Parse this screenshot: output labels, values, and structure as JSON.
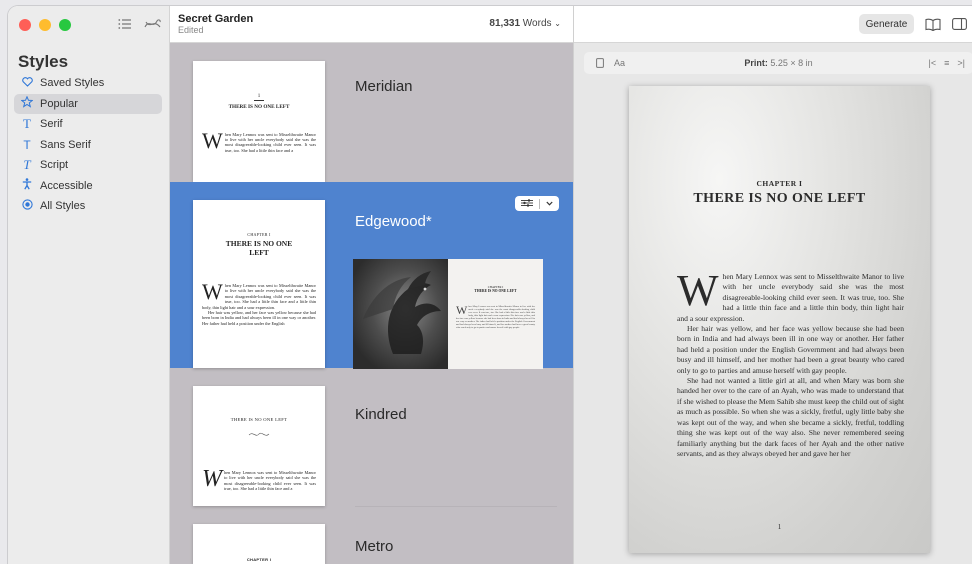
{
  "colors": {
    "accent": "#2f77d8",
    "selected_row": "#4f83cf",
    "traffic_red": "#fe5f57",
    "traffic_yellow": "#febc2e",
    "traffic_green": "#28c840"
  },
  "sidebar": {
    "title": "Styles",
    "items": [
      {
        "label": "Saved Styles",
        "icon": "heart-icon"
      },
      {
        "label": "Popular",
        "icon": "star-icon",
        "active": true
      },
      {
        "label": "Serif",
        "icon": "serif-t-icon"
      },
      {
        "label": "Sans Serif",
        "icon": "sans-t-icon"
      },
      {
        "label": "Script",
        "icon": "script-t-icon"
      },
      {
        "label": "Accessible",
        "icon": "accessibility-icon"
      },
      {
        "label": "All Styles",
        "icon": "circle-dot-icon"
      }
    ]
  },
  "document": {
    "title": "Secret Garden",
    "status": "Edited",
    "word_count": "81,331",
    "word_label": "Words"
  },
  "styles_list": [
    {
      "name": "Meridian",
      "selected": false
    },
    {
      "name": "Edgewood*",
      "selected": true
    },
    {
      "name": "Kindred",
      "selected": false
    },
    {
      "name": "Metro",
      "selected": false
    }
  ],
  "book": {
    "chapter_label": "CHAPTER I",
    "chapter_number": "1",
    "heading": "THERE IS NO ONE LEFT",
    "heading_short1": "THERE IS NO ONE",
    "heading_short2": "LEFT",
    "thumb_p1": "hen Mary Lennox was sent to Misselthwaite Manor to live with her uncle everybody said she was the most disagreeable-looking child ever seen. It was true, too. She had a little thin face and a",
    "thumb_p1b": "hen Mary Lennox was sent to Misselthwaite Manor to live with her uncle everybody said she was the most disagreeable-looking child ever seen. It was true, too. She had a little thin face and a little thin body, thin light hair and a sour expression.",
    "thumb_p2": "Her hair was yellow, and her face was yellow because she had been born in India and had always been ill in one way or another. Her father had held a position under the English",
    "para1": "hen Mary Lennox was sent to Misselthwaite Manor to live with her uncle everybody said she was the most disagreeable-looking child ever seen. It was true, too. She had a little thin face and a little thin body, thin light hair and a sour expression.",
    "para2": "Her hair was yellow, and her face was yellow because she had been born in India and had always been ill in one way or another. Her father had held a position under the English Government and had always been busy and ill himself, and her mother had been a great beauty who cared only to go to parties and amuse herself with gay people.",
    "para3": "She had not wanted a little girl at all, and when Mary was born she handed her over to the care of an Ayah, who was made to understand that if she wished to please the Mem Sahib she must keep the child out of sight as much as possible. So when she was a sickly, fretful, ugly little baby she was kept out of the way, and when she became a sickly, fretful, toddling thing she was kept out of the way also. She never remembered seeing familiarly anything but the dark faces of her Ayah and the other native servants, and as they always obeyed her and gave her her",
    "page_number": "1",
    "dropcap": "W",
    "script_dropcap": "W"
  },
  "preview": {
    "generate_label": "Generate",
    "device_label": "Aa",
    "print_label": "Print:",
    "print_size": "5.25 × 8 in"
  }
}
